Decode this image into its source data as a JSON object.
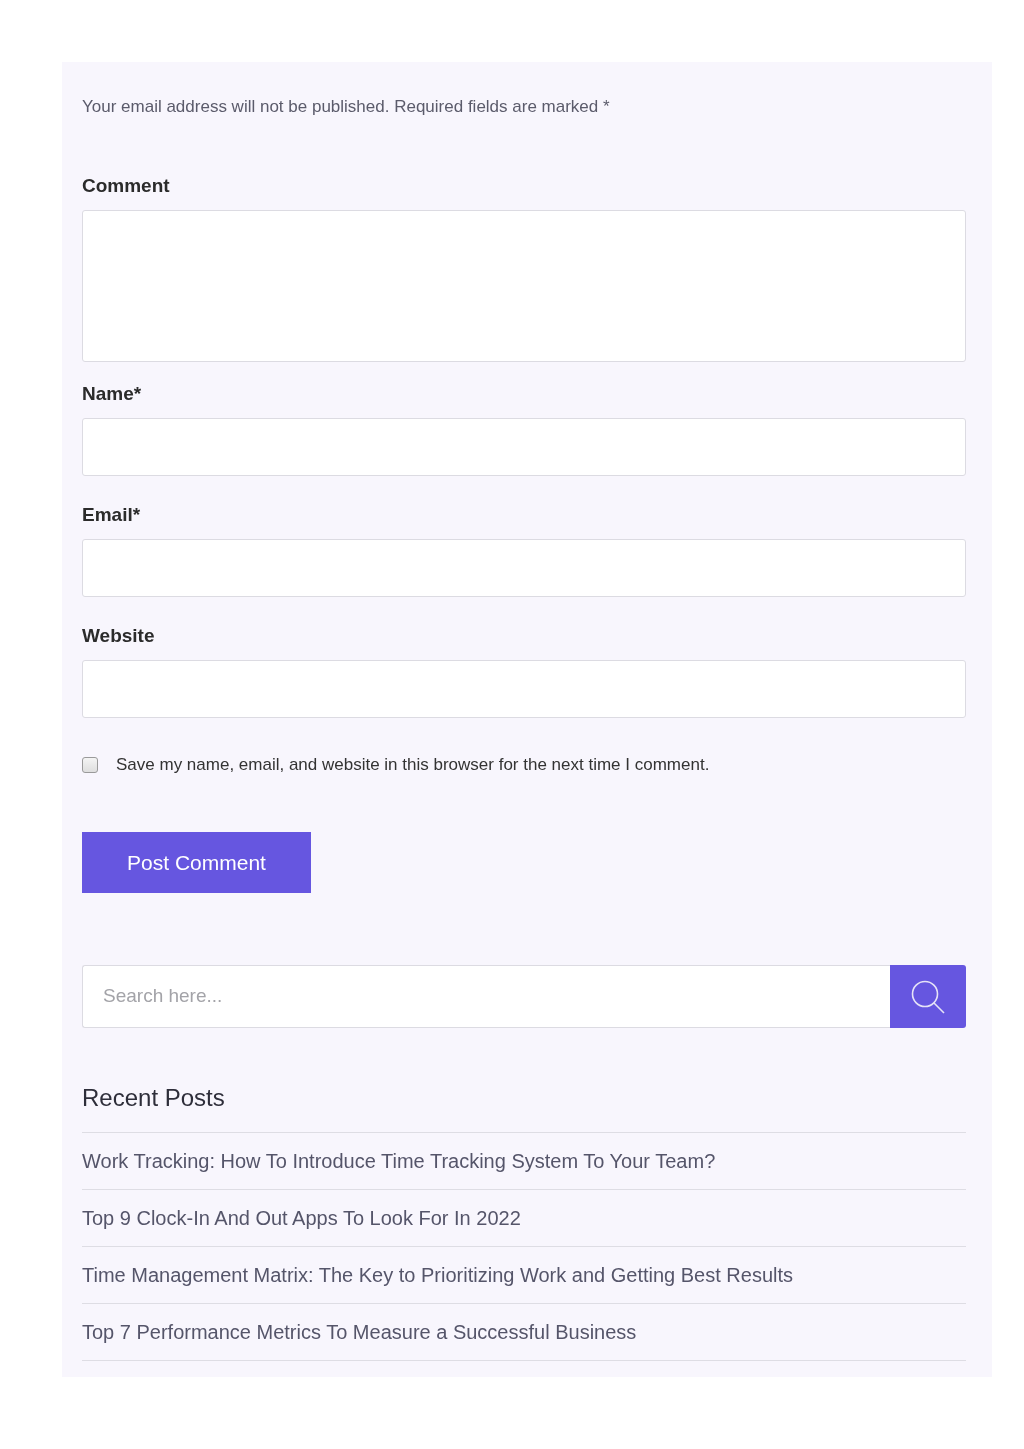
{
  "notice": {
    "text": "Your email address will not be published. Required fields are marked *"
  },
  "fields": [
    {
      "kind": "textarea",
      "label": "Comment"
    },
    {
      "kind": "input",
      "label": "Name*"
    },
    {
      "kind": "input",
      "label": "Email*"
    },
    {
      "kind": "input",
      "label": "Website"
    }
  ],
  "remember": {
    "label": "Save my name, email, and website in this browser for the next time I comment.",
    "checked": false
  },
  "submit": {
    "label": "Post Comment"
  },
  "search": {
    "placeholder": "Search here..."
  },
  "recent_posts": {
    "title": "Recent Posts",
    "items": [
      "Work Tracking: How To Introduce Time Tracking System To Your Team?",
      "Top 9 Clock-In And Out Apps To Look For In 2022",
      "Time Management Matrix: The Key to Prioritizing Work and Getting Best Results",
      "Top 7 Performance Metrics To Measure a Successful Business"
    ]
  }
}
